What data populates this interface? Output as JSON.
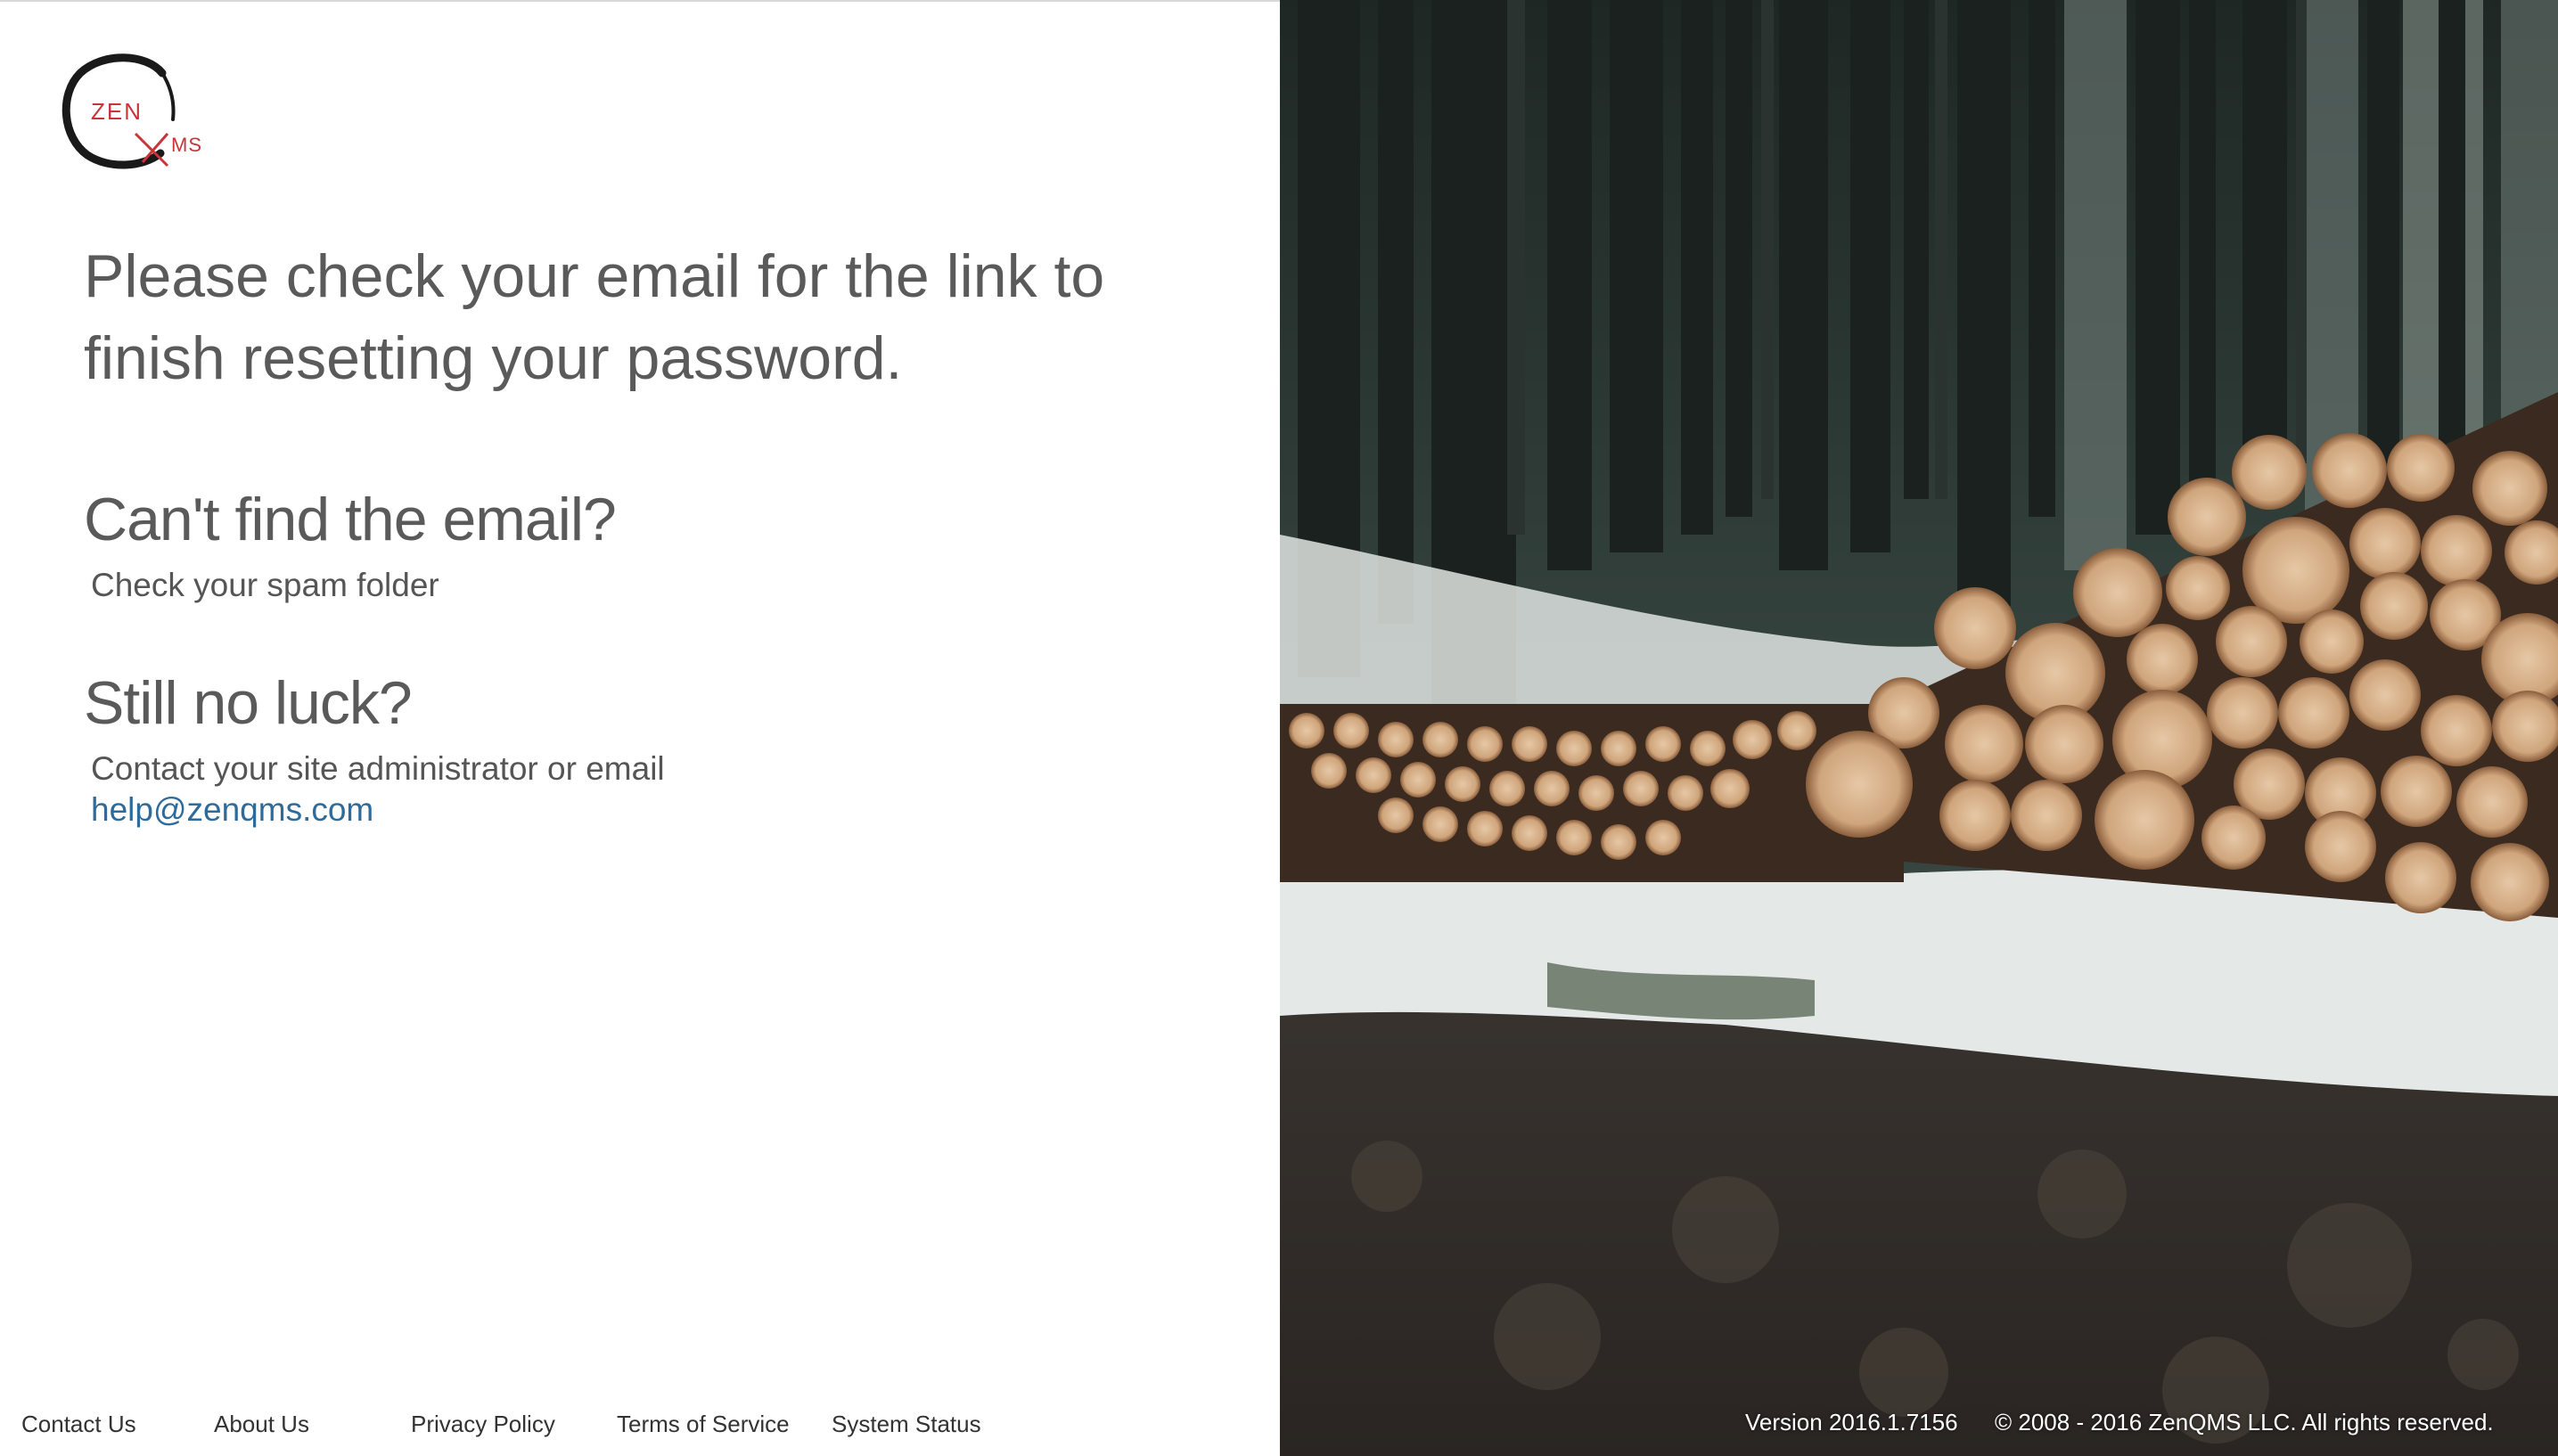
{
  "logo": {
    "zen": "ZEN",
    "ms": "MS"
  },
  "main": {
    "heading": "Please check your email for the link to finish resetting your password.",
    "cant_find_heading": "Can't find the email?",
    "cant_find_text": "Check your spam folder",
    "no_luck_heading": "Still no luck?",
    "no_luck_text_prefix": "Contact your site administrator or email ",
    "help_email": "help@zenqms.com"
  },
  "footer": {
    "links": [
      "Contact Us",
      "About Us",
      "Privacy Policy",
      "Terms of Service",
      "System Status"
    ],
    "version": "Version  2016.1.7156",
    "copyright": "© 2008 - 2016 ZenQMS LLC. All rights reserved."
  },
  "colors": {
    "accent": "#c8343a",
    "link": "#2f6b9a",
    "heading": "#5a5a5a"
  }
}
